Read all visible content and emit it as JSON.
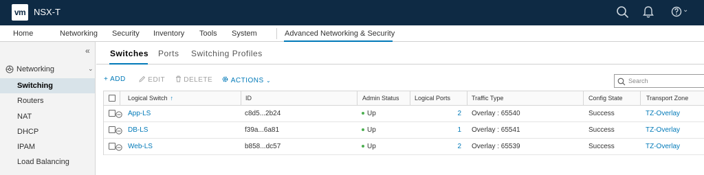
{
  "topbar": {
    "logo_text": "vm",
    "app_name": "NSX-T",
    "icons": [
      "search-icon",
      "bell-icon",
      "help-icon"
    ],
    "help_caret": "⌄"
  },
  "nav": {
    "items": [
      "Home",
      "Networking",
      "Security",
      "Inventory",
      "Tools",
      "System",
      "Advanced Networking & Security"
    ],
    "active": "Advanced Networking & Security"
  },
  "sidebar": {
    "collapse_glyph": "«",
    "group_label": "Networking",
    "group_caret": "⌄",
    "items": [
      "Switching",
      "Routers",
      "NAT",
      "DHCP",
      "IPAM",
      "Load Balancing"
    ],
    "active": "Switching"
  },
  "tabs": {
    "items": [
      "Switches",
      "Ports",
      "Switching Profiles"
    ],
    "active": "Switches"
  },
  "toolbar": {
    "add_label": "+ ADD",
    "edit_label": "EDIT",
    "delete_label": "DELETE",
    "actions_label": "ACTIONS"
  },
  "search": {
    "placeholder": "Search"
  },
  "grid": {
    "columns": [
      "Logical Switch",
      "ID",
      "Admin Status",
      "Logical Ports",
      "Traffic Type",
      "Config State",
      "Transport Zone"
    ],
    "sort_arrow": "↑",
    "rows": [
      {
        "name": "App-LS",
        "id": "c8d5...2b24",
        "admin_status": "Up",
        "ports": "2",
        "traffic": "Overlay : 65540",
        "config_state": "Success",
        "zone": "TZ-Overlay"
      },
      {
        "name": "DB-LS",
        "id": "f39a...6a81",
        "admin_status": "Up",
        "ports": "1",
        "traffic": "Overlay : 65541",
        "config_state": "Success",
        "zone": "TZ-Overlay"
      },
      {
        "name": "Web-LS",
        "id": "b858...dc57",
        "admin_status": "Up",
        "ports": "2",
        "traffic": "Overlay : 65539",
        "config_state": "Success",
        "zone": "TZ-Overlay"
      }
    ]
  },
  "colors": {
    "topbar_bg": "#0e2a44",
    "accent": "#0079b8",
    "status_up": "#4caf50"
  }
}
